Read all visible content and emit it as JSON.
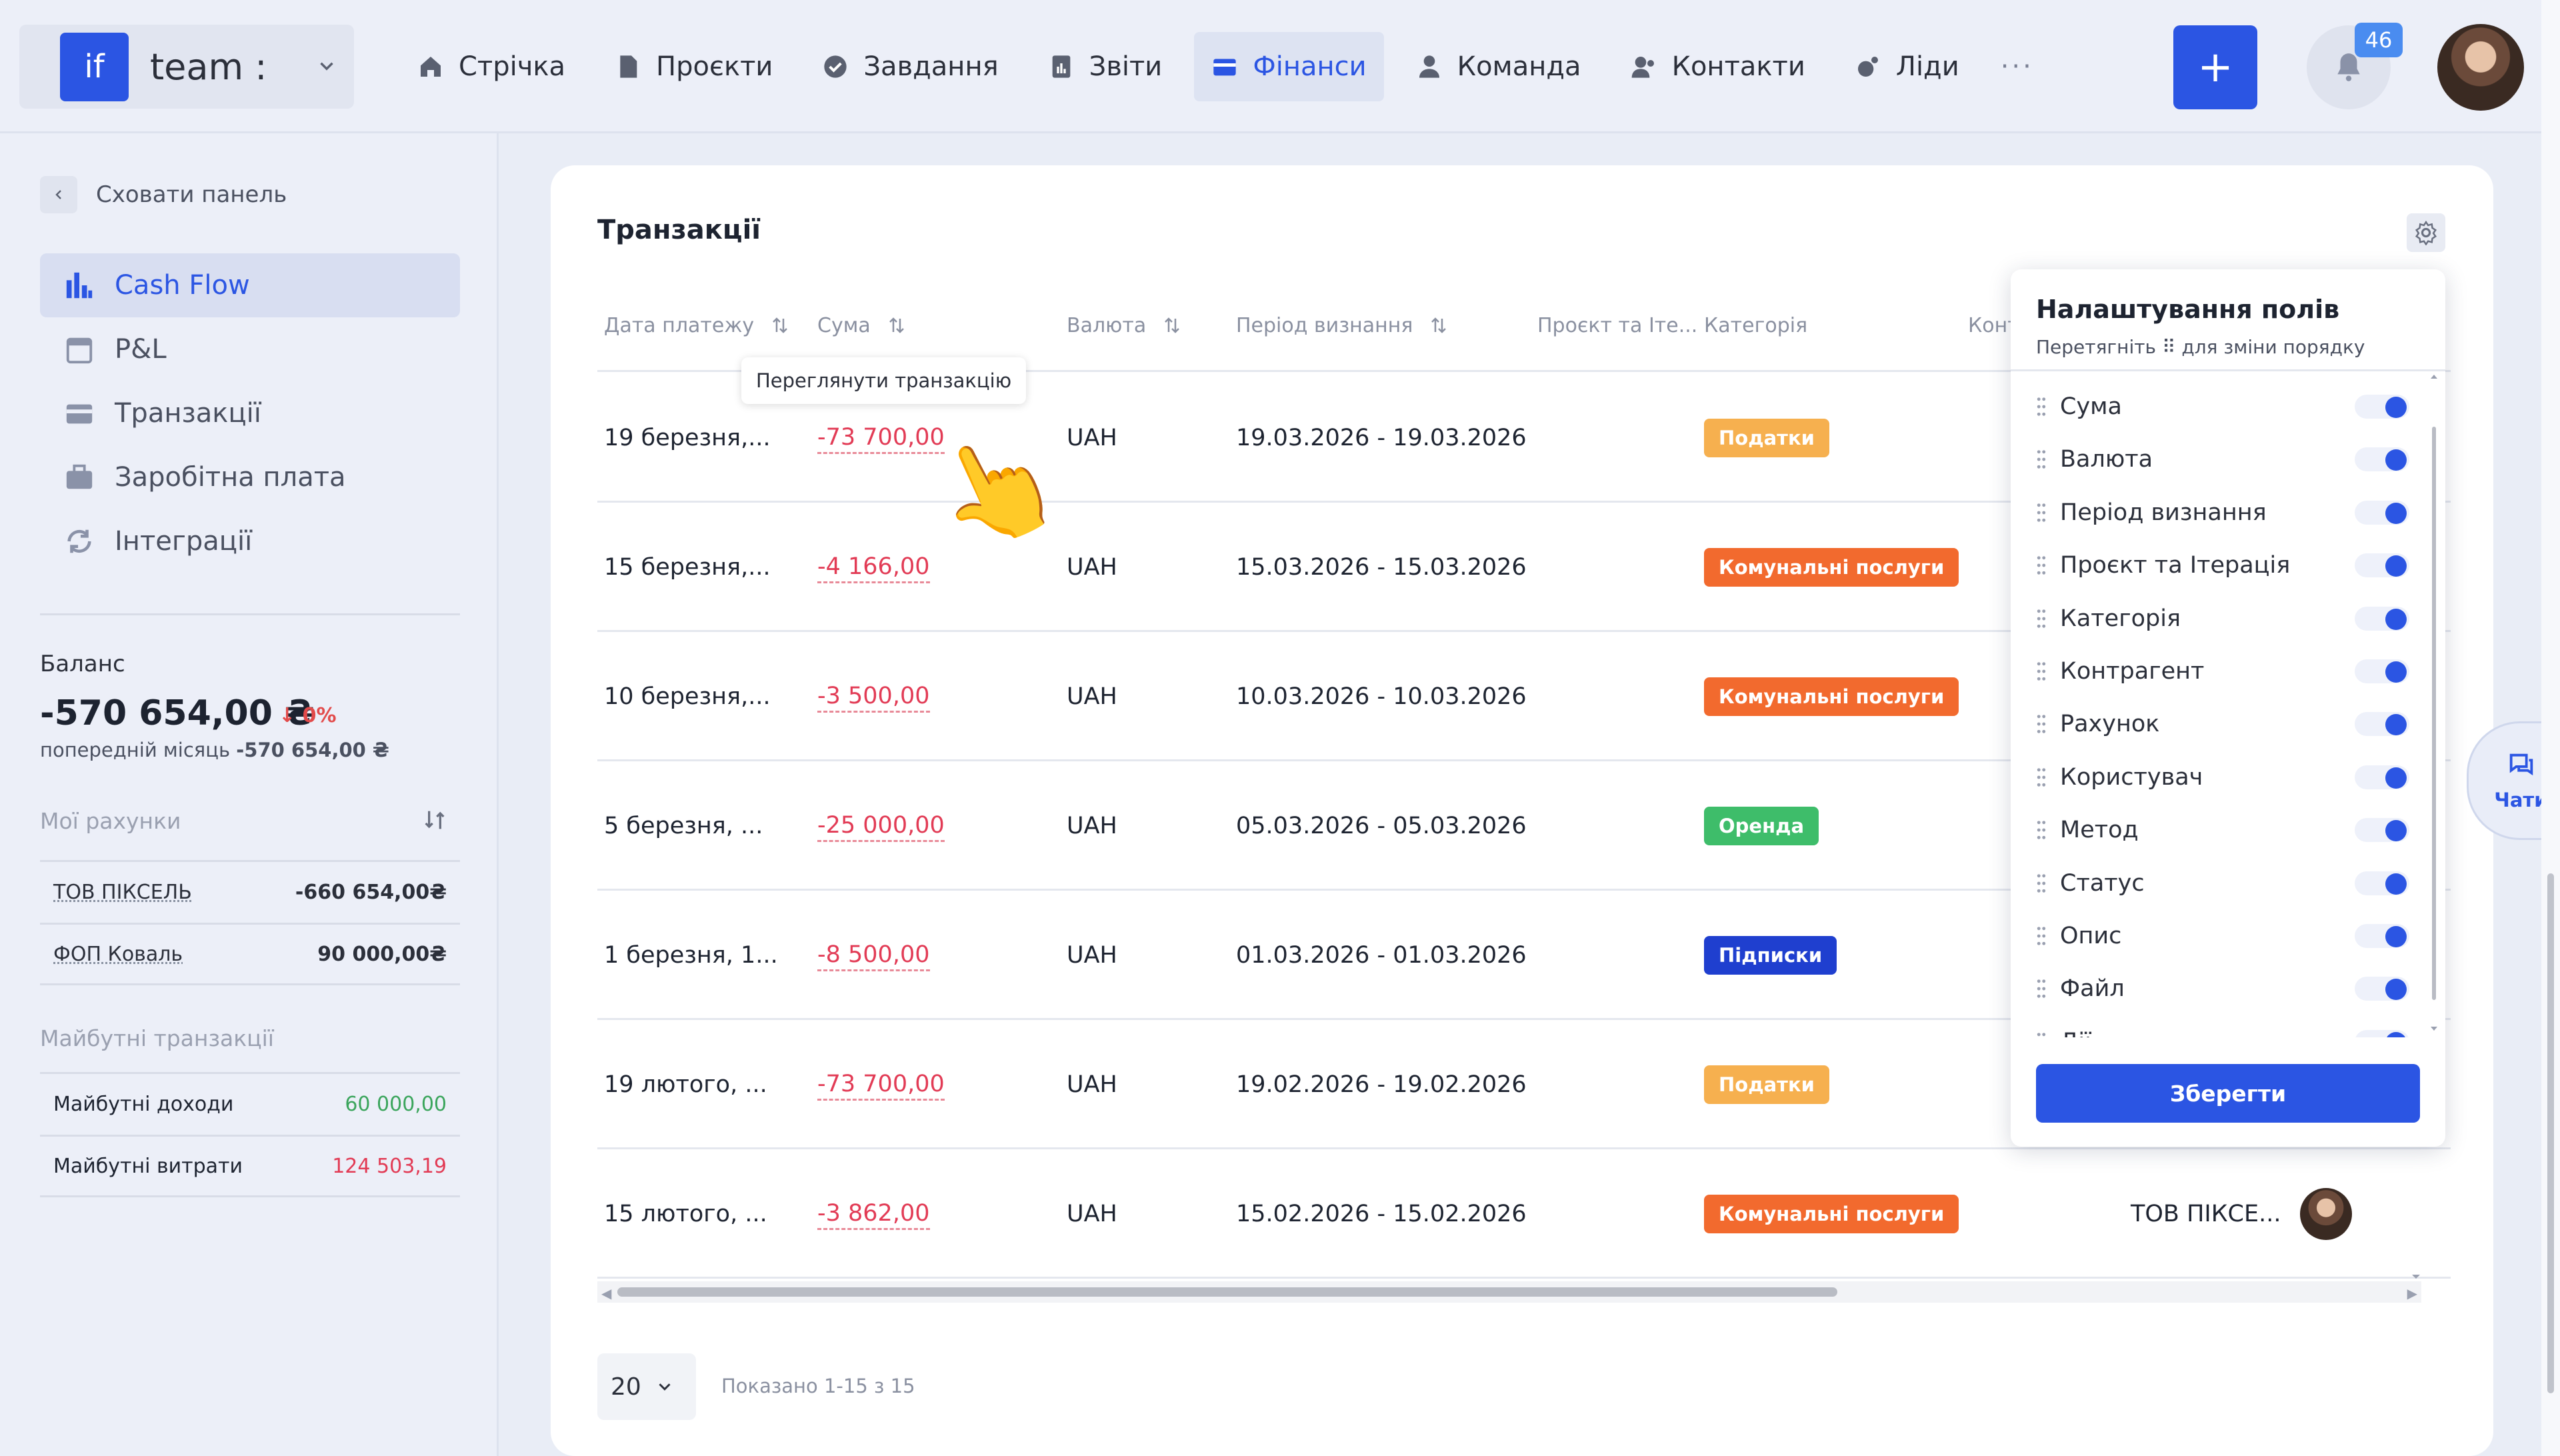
{
  "header": {
    "logo_text": "if",
    "team_name": "team :",
    "nav": [
      {
        "label": "Стрічка",
        "icon": "home-icon"
      },
      {
        "label": "Проєкти",
        "icon": "document-icon"
      },
      {
        "label": "Завдання",
        "icon": "check-circle-icon"
      },
      {
        "label": "Звіти",
        "icon": "report-icon"
      },
      {
        "label": "Фінанси",
        "icon": "wallet-icon",
        "active": true
      },
      {
        "label": "Команда",
        "icon": "person-icon"
      },
      {
        "label": "Контакти",
        "icon": "contacts-icon"
      },
      {
        "label": "Ліди",
        "icon": "leads-icon"
      }
    ],
    "more": "···",
    "add_label": "+",
    "notifications_count": "46"
  },
  "sidebar": {
    "hide_panel": "Сховати панель",
    "menu": [
      {
        "label": "Cash Flow",
        "icon": "bar-chart-icon",
        "active": true
      },
      {
        "label": "P&L",
        "icon": "calendar-icon"
      },
      {
        "label": "Транзакції",
        "icon": "card-icon"
      },
      {
        "label": "Заробітна плата",
        "icon": "briefcase-icon"
      },
      {
        "label": "Інтеграції",
        "icon": "sync-icon"
      }
    ],
    "balance": {
      "label": "Баланс",
      "value": "-570 654,00 ₴",
      "change": "↓ 0%",
      "prev_label": "попередній місяць",
      "prev_value": "-570 654,00 ₴"
    },
    "accounts_title": "Мої рахунки",
    "accounts": [
      {
        "name": "ТОВ ПІКСЕЛЬ",
        "value": "-660 654,00₴"
      },
      {
        "name": "ФОП Коваль",
        "value": "90 000,00₴"
      }
    ],
    "future_title": "Майбутні транзакції",
    "future": [
      {
        "name": "Майбутні доходи",
        "value": "60 000,00",
        "tone": "pos"
      },
      {
        "name": "Майбутні витрати",
        "value": "124 503,19",
        "tone": "neg"
      }
    ]
  },
  "main": {
    "title": "Транзакції",
    "columns": {
      "date": "Дата платежу",
      "amount": "Сума",
      "currency": "Валюта",
      "period": "Період визнання",
      "project": "Проєкт та Іте...",
      "category": "Категорія",
      "counterparty": "Конт"
    },
    "rows": [
      {
        "date": "19 березня,...",
        "amount": "-73 700,00",
        "currency": "UAH",
        "period": "19.03.2026 - 19.03.2026",
        "category": "Податки",
        "category_color": "#f6b04f"
      },
      {
        "date": "15 березня,...",
        "amount": "-4 166,00",
        "currency": "UAH",
        "period": "15.03.2026 - 15.03.2026",
        "category": "Комунальні послуги",
        "category_color": "#f26a2e"
      },
      {
        "date": "10 березня,...",
        "amount": "-3 500,00",
        "currency": "UAH",
        "period": "10.03.2026 - 10.03.2026",
        "category": "Комунальні послуги",
        "category_color": "#f26a2e"
      },
      {
        "date": "5 березня, ...",
        "amount": "-25 000,00",
        "currency": "UAH",
        "period": "05.03.2026 - 05.03.2026",
        "category": "Оренда",
        "category_color": "#3ebd6a"
      },
      {
        "date": "1 березня, 1...",
        "amount": "-8 500,00",
        "currency": "UAH",
        "period": "01.03.2026 - 01.03.2026",
        "category": "Підписки",
        "category_color": "#1f3fcf"
      },
      {
        "date": "19 лютого, ...",
        "amount": "-73 700,00",
        "currency": "UAH",
        "period": "19.02.2026 - 19.02.2026",
        "category": "Податки",
        "category_color": "#f6b04f"
      },
      {
        "date": "15 лютого, ...",
        "amount": "-3 862,00",
        "currency": "UAH",
        "period": "15.02.2026 - 15.02.2026",
        "category": "Комунальні послуги",
        "category_color": "#f26a2e",
        "counterparty": "ТОВ ПІКСЕ..."
      }
    ],
    "tooltip": "Переглянути транзакцію",
    "page_size": "20",
    "shown": "Показано 1-15 з 15"
  },
  "field_settings": {
    "title": "Налаштування полів",
    "subtitle": "Перетягніть ⠿ для зміни порядку",
    "fields": [
      "Сума",
      "Валюта",
      "Період визнання",
      "Проєкт та Ітерація",
      "Категорія",
      "Контрагент",
      "Рахунок",
      "Користувач",
      "Метод",
      "Статус",
      "Опис",
      "Файл",
      "Дії"
    ],
    "save_label": "Зберегти"
  },
  "chat": {
    "label": "Чати"
  },
  "colors": {
    "accent": "#2b55e3",
    "negative": "#e23b55",
    "positive": "#3ba55c"
  }
}
